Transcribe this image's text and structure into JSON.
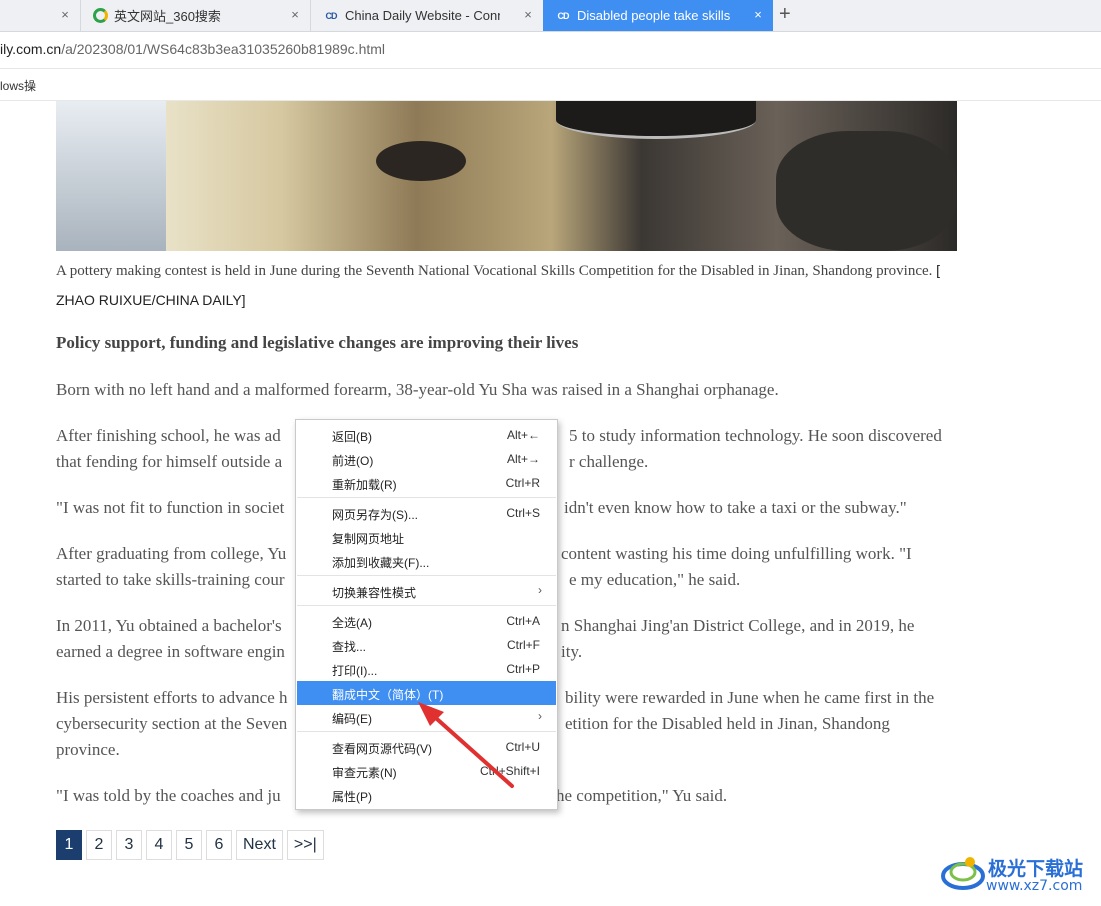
{
  "tabs": [
    {
      "title": "",
      "icon": ""
    },
    {
      "title": "英文网站_360搜索",
      "icon": "360-search-icon"
    },
    {
      "title": "China Daily Website - Connec",
      "icon": "chinadaily-icon"
    },
    {
      "title": "Disabled people take skills r",
      "icon": "chinadaily-icon",
      "active": true
    }
  ],
  "tab_close_glyph": "×",
  "new_tab_glyph": "+",
  "address": {
    "domain": "ily.com.cn",
    "path": "/a/202308/01/WS64c83b3ea31035260b81989c.html"
  },
  "bookmark": {
    "label": "lows操"
  },
  "article": {
    "caption_text": "A pottery making contest is held in June during the Seventh National Vocational Skills Competition for the Disabled in Jinan, Shandong province.",
    "caption_credit": "[ ZHAO RUIXUE/CHINA DAILY]",
    "subhead": "Policy support, funding and legislative changes are improving their lives",
    "p1": "Born with no left hand and a malformed forearm, 38-year-old Yu Sha was raised in a Shanghai orphanage.",
    "p2a": "After finishing school, he was ad",
    "p2b": "5 to study information technology. He soon discovered",
    "p2c": "that fending for himself outside a",
    "p2d": "r challenge.",
    "p3a": "\"I was not fit to function in societ",
    "p3b": "idn't even know how to take a taxi or the subway.\"",
    "p4a": "After graduating from college, Yu",
    "p4b": "content wasting his time doing unfulfilling work. \"I",
    "p4c": "started to take skills-training cour",
    "p4d": "e my education,\" he said.",
    "p5a": "In 2011, Yu obtained a bachelor's",
    "p5b": "n Shanghai Jing'an District College, and in 2019, he",
    "p5c": "earned a degree in software engin",
    "p5d": "ity.",
    "p6a": "His persistent efforts to advance h",
    "p6b": "bility were rewarded in June when he came first in the",
    "p6c": "cybersecurity section at the Seven",
    "p6d": "etition for the Disabled held in Jinan, Shandong",
    "p6e": "province.",
    "p7a": "\"I was told by the coaches and ju",
    "p7b": "he competition,\" Yu said."
  },
  "pagination": {
    "pages": [
      "1",
      "2",
      "3",
      "4",
      "5",
      "6"
    ],
    "active": "1",
    "next": "Next",
    "last": ">>|"
  },
  "context_menu": {
    "items": [
      {
        "label": "返回(B)",
        "shortcut": "Alt+←"
      },
      {
        "label": "前进(O)",
        "shortcut": "Alt+→"
      },
      {
        "label": "重新加载(R)",
        "shortcut": "Ctrl+R"
      },
      {
        "label": "网页另存为(S)...",
        "shortcut": "Ctrl+S"
      },
      {
        "label": "复制网页地址",
        "shortcut": ""
      },
      {
        "label": "添加到收藏夹(F)...",
        "shortcut": ""
      },
      {
        "label": "切换兼容性模式",
        "shortcut": ""
      },
      {
        "label": "全选(A)",
        "shortcut": "Ctrl+A"
      },
      {
        "label": "查找...",
        "shortcut": "Ctrl+F"
      },
      {
        "label": "打印(I)...",
        "shortcut": "Ctrl+P"
      },
      {
        "label": "翻成中文（简体）(T)",
        "shortcut": ""
      },
      {
        "label": "编码(E)",
        "shortcut": ""
      },
      {
        "label": "查看网页源代码(V)",
        "shortcut": "Ctrl+U"
      },
      {
        "label": "审查元素(N)",
        "shortcut": "Ctrl+Shift+I"
      },
      {
        "label": "属性(P)",
        "shortcut": ""
      }
    ],
    "submenu_arrow": "›",
    "highlighted": "翻成中文（简体）(T)"
  },
  "watermark": {
    "title": "极光下载站",
    "url": "www.xz7.com"
  },
  "colors": {
    "accent": "#3f8ef1",
    "pager_active": "#1b3e6f",
    "annotation": "#e03030"
  }
}
